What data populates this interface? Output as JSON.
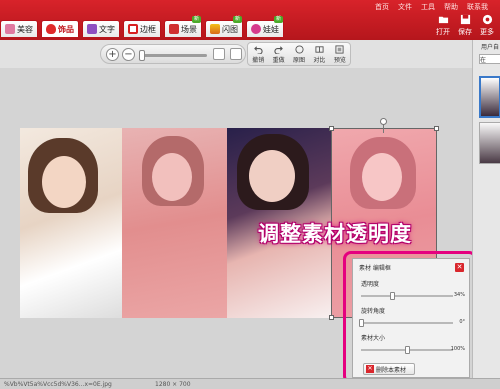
{
  "menu": [
    "首页",
    "文件",
    "工具",
    "帮助",
    "联系我"
  ],
  "tabs": [
    {
      "label": "美容",
      "icon": "beauty-icon",
      "color": "#e07aa0",
      "badge": ""
    },
    {
      "label": "饰品",
      "icon": "heart-icon",
      "color": "#e02a2a",
      "badge": "",
      "active": true
    },
    {
      "label": "文字",
      "icon": "text-icon",
      "color": "#8e4fc0",
      "badge": ""
    },
    {
      "label": "边框",
      "icon": "frame-icon",
      "color": "#d82020",
      "badge": ""
    },
    {
      "label": "场景",
      "icon": "scene-icon",
      "color": "#d03030",
      "badge": "新"
    },
    {
      "label": "闪图",
      "icon": "flash-icon",
      "color": "#d86a1a",
      "badge": "新"
    },
    {
      "label": "娃娃",
      "icon": "doll-icon",
      "color": "#d63a8c",
      "badge": "新"
    }
  ],
  "actions": {
    "open": "打开",
    "save": "保存",
    "more": "更多"
  },
  "toolbar": {
    "zoom_in": "+",
    "zoom_out": "−",
    "undo": "撤销",
    "redo": "重做",
    "original": "原图",
    "compare": "对比",
    "preview": "预览"
  },
  "overlay_text": "调整素材透明度",
  "panel": {
    "title": "素材 编辑框",
    "close": "✕",
    "opacity_label": "透明度",
    "opacity_value": "34%",
    "opacity_level": 0.34,
    "rotate_label": "旋转角度",
    "rotate_value": "0°",
    "rotate_level": 0.0,
    "size_label": "素材大小",
    "size_value": "100%",
    "size_level": 0.5,
    "delete_button": "删除本素材"
  },
  "sidebar": {
    "title": "用户自",
    "button": "在"
  },
  "status": {
    "file": "%Vb%Vt5a%Vcc5d%V36...x=0E.jpg",
    "dims": "1280 × 700"
  },
  "colors": {
    "brand_red": "#c81820",
    "highlight_pink": "#e5007f"
  }
}
